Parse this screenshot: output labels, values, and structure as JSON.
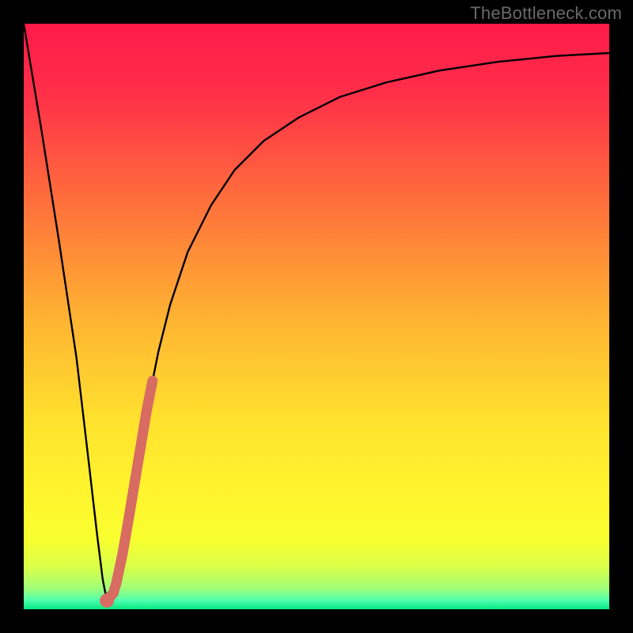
{
  "watermark": "TheBottleneck.com",
  "colors": {
    "frame": "#000000",
    "gradient_stops": [
      {
        "offset": 0.0,
        "color": "#ff1a49"
      },
      {
        "offset": 0.12,
        "color": "#ff2f49"
      },
      {
        "offset": 0.3,
        "color": "#ff6e3c"
      },
      {
        "offset": 0.5,
        "color": "#ffb232"
      },
      {
        "offset": 0.68,
        "color": "#ffe22e"
      },
      {
        "offset": 0.8,
        "color": "#fff42e"
      },
      {
        "offset": 0.88,
        "color": "#f9ff2f"
      },
      {
        "offset": 0.93,
        "color": "#d7ff4a"
      },
      {
        "offset": 0.965,
        "color": "#9fff7a"
      },
      {
        "offset": 0.985,
        "color": "#4dffad"
      },
      {
        "offset": 1.0,
        "color": "#05e880"
      }
    ],
    "curve": "#000000",
    "marker": "#d86b62"
  },
  "chart_data": {
    "type": "line",
    "title": "",
    "xlabel": "",
    "ylabel": "",
    "xlim": [
      0,
      100
    ],
    "ylim": [
      0,
      100
    ],
    "note": "Axes are unlabeled in the image; values are estimated as percentages of the plot area (0 = left/bottom, 100 = right/top).",
    "series": [
      {
        "name": "bottleneck-curve",
        "x": [
          0,
          3,
          6,
          9,
          11,
          12.5,
          13.5,
          14.2,
          15.5,
          17,
          19,
          21,
          23,
          25,
          28,
          32,
          36,
          41,
          47,
          54,
          62,
          71,
          81,
          91,
          100
        ],
        "y": [
          100,
          82,
          63,
          43,
          26,
          13,
          5,
          1.5,
          3,
          10,
          22,
          34,
          44,
          52,
          61,
          69,
          75,
          80,
          84,
          87.5,
          90,
          92,
          93.5,
          94.5,
          95
        ]
      }
    ],
    "highlight_segment": {
      "name": "highlighted-range",
      "x": [
        14.8,
        22.0
      ],
      "y": [
        2.0,
        38.0
      ]
    },
    "minimum_point": {
      "x": 14.2,
      "y": 1.5
    }
  }
}
